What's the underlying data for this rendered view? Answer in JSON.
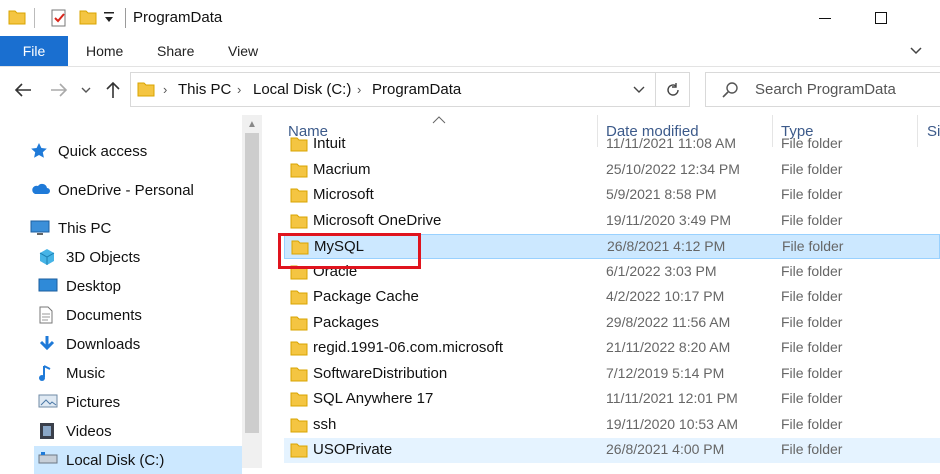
{
  "window": {
    "title": "ProgramData",
    "qat_dropdown_icon": "dropdown-arrow",
    "minimize_icon": "minimize-icon",
    "maximize_icon": "maximize-icon"
  },
  "ribbon": {
    "tabs": [
      "File",
      "Home",
      "Share",
      "View"
    ]
  },
  "address": {
    "crumbs": [
      "This PC",
      "Local Disk (C:)",
      "ProgramData"
    ],
    "separator": "›"
  },
  "search": {
    "placeholder": "Search ProgramData"
  },
  "nav": {
    "items": [
      {
        "label": "Quick access",
        "icon": "star-icon"
      },
      {
        "label": "OneDrive - Personal",
        "icon": "cloud-icon"
      },
      {
        "label": "This PC",
        "icon": "monitor-icon"
      },
      {
        "label": "3D Objects",
        "icon": "cube-icon"
      },
      {
        "label": "Desktop",
        "icon": "desktop-icon"
      },
      {
        "label": "Documents",
        "icon": "document-icon"
      },
      {
        "label": "Downloads",
        "icon": "download-icon"
      },
      {
        "label": "Music",
        "icon": "music-icon"
      },
      {
        "label": "Pictures",
        "icon": "picture-icon"
      },
      {
        "label": "Videos",
        "icon": "video-icon"
      },
      {
        "label": "Local Disk (C:)",
        "icon": "drive-icon"
      }
    ]
  },
  "files": {
    "columns": {
      "name": "Name",
      "date": "Date modified",
      "type": "Type",
      "size": "Siz"
    },
    "rows": [
      {
        "name": "Intuit",
        "date": "11/11/2021 11:08 AM",
        "type": "File folder"
      },
      {
        "name": "Macrium",
        "date": "25/10/2022 12:34 PM",
        "type": "File folder"
      },
      {
        "name": "Microsoft",
        "date": "5/9/2021 8:58 PM",
        "type": "File folder"
      },
      {
        "name": "Microsoft OneDrive",
        "date": "19/11/2020 3:49 PM",
        "type": "File folder"
      },
      {
        "name": "MySQL",
        "date": "26/8/2021 4:12 PM",
        "type": "File folder",
        "selected": true
      },
      {
        "name": "Oracle",
        "date": "6/1/2022 3:03 PM",
        "type": "File folder"
      },
      {
        "name": "Package Cache",
        "date": "4/2/2022 10:17 PM",
        "type": "File folder"
      },
      {
        "name": "Packages",
        "date": "29/8/2022 11:56 AM",
        "type": "File folder"
      },
      {
        "name": "regid.1991-06.com.microsoft",
        "date": "21/11/2022 8:20 AM",
        "type": "File folder"
      },
      {
        "name": "SoftwareDistribution",
        "date": "7/12/2019 5:14 PM",
        "type": "File folder"
      },
      {
        "name": "SQL Anywhere 17",
        "date": "11/11/2021 12:01 PM",
        "type": "File folder"
      },
      {
        "name": "ssh",
        "date": "19/11/2020 10:53 AM",
        "type": "File folder"
      },
      {
        "name": "USOPrivate",
        "date": "26/8/2021 4:00 PM",
        "type": "File folder",
        "hover": true
      }
    ]
  },
  "colors": {
    "accent": "#1a6fd0",
    "folder": "#f4c542",
    "selection": "#cce8ff",
    "highlight_box": "#e0141e"
  }
}
